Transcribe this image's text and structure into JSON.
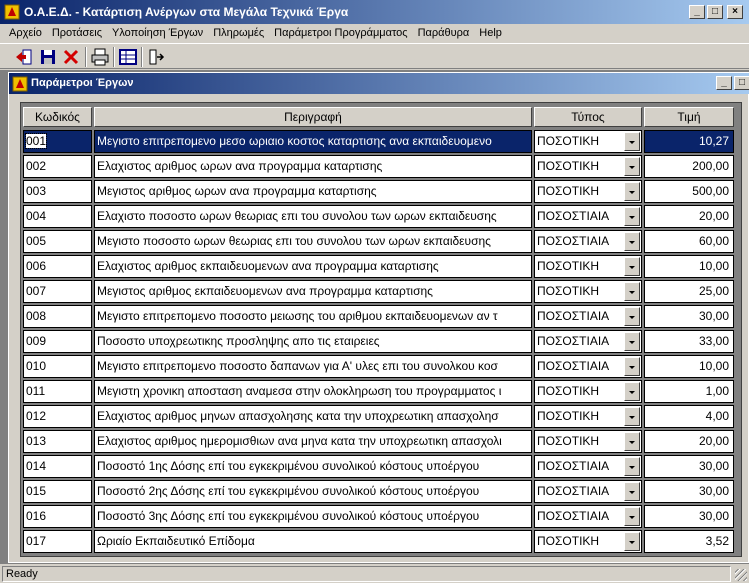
{
  "window": {
    "title": "Ο.Α.Ε.Δ. - Κατάρτιση Ανέργων στα Μεγάλα Τεχνικά Έργα",
    "minimize": "_",
    "maximize": "□",
    "close": "×"
  },
  "menu": [
    {
      "label": "Αρχείο"
    },
    {
      "label": "Προτάσεις"
    },
    {
      "label": "Υλοποίηση Έργων"
    },
    {
      "label": "Πληρωμές"
    },
    {
      "label": "Παράμετροι Προγράμματος"
    },
    {
      "label": "Παράθυρα"
    },
    {
      "label": "Help"
    }
  ],
  "toolbar": {
    "icons": [
      "exit-icon",
      "save-icon",
      "delete-icon",
      "print-icon",
      "grid-icon",
      "export-icon"
    ],
    "colors": {
      "delete": "#d40000",
      "save": "#000080"
    }
  },
  "child": {
    "title": "Παράμετροι Έργων",
    "minimize": "_",
    "restore": "□"
  },
  "grid": {
    "headers": [
      "Κωδικός",
      "Περιγραφή",
      "Τύπος",
      "Τιμή"
    ],
    "rows": [
      {
        "code": "001",
        "desc": "Μεγιστο επιτρεπομενο μεσο ωριαιο κοστος καταρτισης ανα εκπαιδευομενο",
        "type": "ΠΟΣΟΤΙΚΗ",
        "value": "10,27"
      },
      {
        "code": "002",
        "desc": "Ελαχιστος αριθμος ωρων ανα προγραμμα καταρτισης",
        "type": "ΠΟΣΟΤΙΚΗ",
        "value": "200,00"
      },
      {
        "code": "003",
        "desc": "Μεγιστος αριθμος ωρων ανα προγραμμα καταρτισης",
        "type": "ΠΟΣΟΤΙΚΗ",
        "value": "500,00"
      },
      {
        "code": "004",
        "desc": "Ελαχιστο ποσοστο ωρων θεωριας επι του συνολου των ωρων εκπαιδευσης",
        "type": "ΠΟΣΟΣΤΙΑΙΑ",
        "value": "20,00"
      },
      {
        "code": "005",
        "desc": "Μεγιστο ποσοστο ωρων θεωριας επι του συνολου των ωρων εκπαιδευσης",
        "type": "ΠΟΣΟΣΤΙΑΙΑ",
        "value": "60,00"
      },
      {
        "code": "006",
        "desc": "Ελαχιστος αριθμος εκπαιδευομενων ανα προγραμμα καταρτισης",
        "type": "ΠΟΣΟΤΙΚΗ",
        "value": "10,00"
      },
      {
        "code": "007",
        "desc": "Μεγιστος αριθμος εκπαιδευομενων ανα προγραμμα καταρτισης",
        "type": "ΠΟΣΟΤΙΚΗ",
        "value": "25,00"
      },
      {
        "code": "008",
        "desc": "Μεγιστο επιτρεπομενο ποσοστο μειωσης του αριθμου εκπαιδευομενων αν τ",
        "type": "ΠΟΣΟΣΤΙΑΙΑ",
        "value": "30,00"
      },
      {
        "code": "009",
        "desc": "Ποσοστο υποχρεωτικης προσληψης απο τις εταιρειες",
        "type": "ΠΟΣΟΣΤΙΑΙΑ",
        "value": "33,00"
      },
      {
        "code": "010",
        "desc": "Μεγιστο επιτρεπομενο ποσοστο δαπανων για Α' υλες επι του συνολκου κοσ",
        "type": "ΠΟΣΟΣΤΙΑΙΑ",
        "value": "10,00"
      },
      {
        "code": "011",
        "desc": "Μεγιστη χρονικη αποσταση αναμεσα στην ολοκληρωση του προγραμματος ι",
        "type": "ΠΟΣΟΤΙΚΗ",
        "value": "1,00"
      },
      {
        "code": "012",
        "desc": "Ελαχιστος αριθμος μηνων απασχολησης κατα την υποχρεωτικη απασχολησ",
        "type": "ΠΟΣΟΤΙΚΗ",
        "value": "4,00"
      },
      {
        "code": "013",
        "desc": "Ελαχιστος αριθμος ημερομισθιων ανα μηνα κατα την υποχρεωτικη απασχολι",
        "type": "ΠΟΣΟΤΙΚΗ",
        "value": "20,00"
      },
      {
        "code": "014",
        "desc": "Ποσοστό 1ης Δόσης επί του εγκεκριμένου συνολικού κόστους υποέργου",
        "type": "ΠΟΣΟΣΤΙΑΙΑ",
        "value": "30,00"
      },
      {
        "code": "015",
        "desc": "Ποσοστό 2ης Δόσης επί του εγκεκριμένου συνολικού κόστους υποέργου",
        "type": "ΠΟΣΟΣΤΙΑΙΑ",
        "value": "30,00"
      },
      {
        "code": "016",
        "desc": "Ποσοστό 3ης Δόσης επί του εγκεκριμένου συνολικού κόστους υποέργου",
        "type": "ΠΟΣΟΣΤΙΑΙΑ",
        "value": "30,00"
      },
      {
        "code": "017",
        "desc": "Ωριαίο Εκπαιδευτικό Επίδομα",
        "type": "ΠΟΣΟΤΙΚΗ",
        "value": "3,52"
      }
    ],
    "selected_row": 0,
    "selection_color": "#0a246a"
  },
  "status": {
    "text": "Ready"
  }
}
